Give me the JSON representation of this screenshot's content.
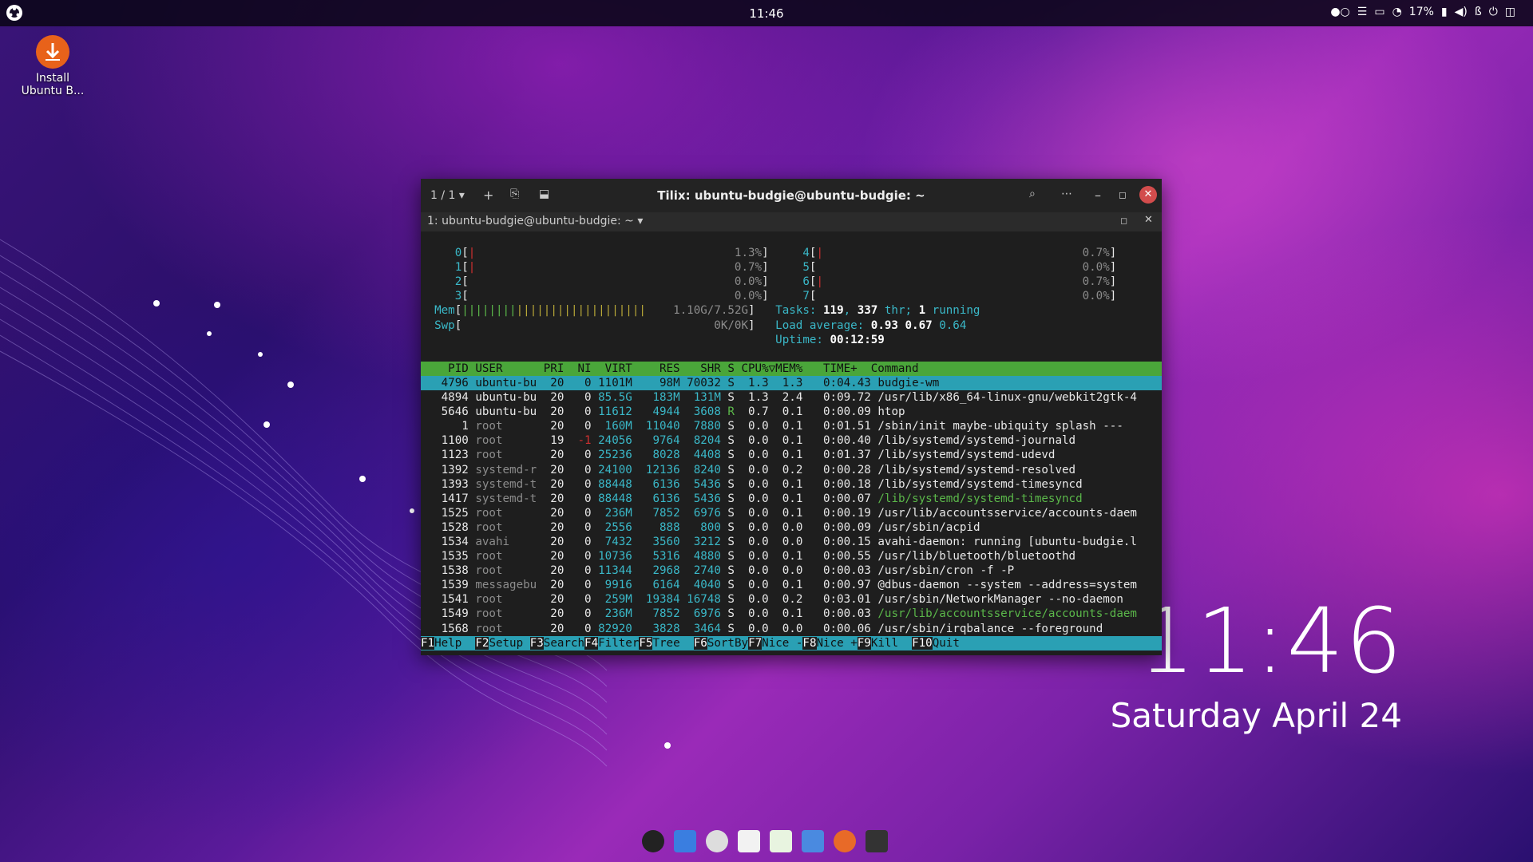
{
  "top_panel": {
    "clock": "11:46",
    "tray": {
      "battery": "17%"
    }
  },
  "desktop_icons": [
    {
      "label": "Install Ubuntu B..."
    }
  ],
  "desktop_clock": {
    "time": "11:46",
    "date": "Saturday April 24"
  },
  "terminal": {
    "session_indicator": "1 / 1",
    "title": "Tilix: ubuntu-budgie@ubuntu-budgie: ~",
    "tab_label": "1: ubuntu-budgie@ubuntu-budgie: ~",
    "cpus": [
      {
        "id": "0",
        "value": "1.3%"
      },
      {
        "id": "1",
        "value": "0.7%"
      },
      {
        "id": "2",
        "value": "0.0%"
      },
      {
        "id": "3",
        "value": "0.0%"
      },
      {
        "id": "4",
        "value": "0.7%"
      },
      {
        "id": "5",
        "value": "0.0%"
      },
      {
        "id": "6",
        "value": "0.7%"
      },
      {
        "id": "7",
        "value": "0.0%"
      }
    ],
    "mem": "1.10G/7.52G",
    "swp": "0K/0K",
    "tasks": {
      "label": "Tasks:",
      "count": "119",
      "thr": "337",
      "thr_label": "thr;",
      "running": "1",
      "running_label": "running"
    },
    "load": {
      "label": "Load average:",
      "a": "0.93",
      "b": "0.67",
      "c": "0.64"
    },
    "uptime": {
      "label": "Uptime:",
      "value": "00:12:59"
    },
    "columns": [
      "PID",
      "USER",
      "PRI",
      "NI",
      "VIRT",
      "RES",
      "SHR",
      "S",
      "CPU%",
      "MEM%",
      "TIME+",
      "Command"
    ],
    "processes": [
      {
        "pid": "4796",
        "user": "ubuntu-bu",
        "pri": "20",
        "ni": "0",
        "virt": "1101M",
        "res": "98M",
        "shr": "70032",
        "s": "S",
        "cpu": "1.3",
        "mem": "1.3",
        "time": "0:04.43",
        "cmd": "budgie-wm"
      },
      {
        "pid": "4894",
        "user": "ubuntu-bu",
        "pri": "20",
        "ni": "0",
        "virt": "85.5G",
        "res": "183M",
        "shr": "131M",
        "s": "S",
        "cpu": "1.3",
        "mem": "2.4",
        "time": "0:09.72",
        "cmd": "/usr/lib/x86_64-linux-gnu/webkit2gtk-4"
      },
      {
        "pid": "5646",
        "user": "ubuntu-bu",
        "pri": "20",
        "ni": "0",
        "virt": "11612",
        "res": "4944",
        "shr": "3608",
        "s": "R",
        "cpu": "0.7",
        "mem": "0.1",
        "time": "0:00.09",
        "cmd": "htop"
      },
      {
        "pid": "1",
        "user": "root",
        "pri": "20",
        "ni": "0",
        "virt": "160M",
        "res": "11040",
        "shr": "7880",
        "s": "S",
        "cpu": "0.0",
        "mem": "0.1",
        "time": "0:01.51",
        "cmd": "/sbin/init maybe-ubiquity splash ---"
      },
      {
        "pid": "1100",
        "user": "root",
        "pri": "19",
        "ni": "-1",
        "virt": "24056",
        "res": "9764",
        "shr": "8204",
        "s": "S",
        "cpu": "0.0",
        "mem": "0.1",
        "time": "0:00.40",
        "cmd": "/lib/systemd/systemd-journald"
      },
      {
        "pid": "1123",
        "user": "root",
        "pri": "20",
        "ni": "0",
        "virt": "25236",
        "res": "8028",
        "shr": "4408",
        "s": "S",
        "cpu": "0.0",
        "mem": "0.1",
        "time": "0:01.37",
        "cmd": "/lib/systemd/systemd-udevd"
      },
      {
        "pid": "1392",
        "user": "systemd-r",
        "pri": "20",
        "ni": "0",
        "virt": "24100",
        "res": "12136",
        "shr": "8240",
        "s": "S",
        "cpu": "0.0",
        "mem": "0.2",
        "time": "0:00.28",
        "cmd": "/lib/systemd/systemd-resolved"
      },
      {
        "pid": "1393",
        "user": "systemd-t",
        "pri": "20",
        "ni": "0",
        "virt": "88448",
        "res": "6136",
        "shr": "5436",
        "s": "S",
        "cpu": "0.0",
        "mem": "0.1",
        "time": "0:00.18",
        "cmd": "/lib/systemd/systemd-timesyncd"
      },
      {
        "pid": "1417",
        "user": "systemd-t",
        "pri": "20",
        "ni": "0",
        "virt": "88448",
        "res": "6136",
        "shr": "5436",
        "s": "S",
        "cpu": "0.0",
        "mem": "0.1",
        "time": "0:00.07",
        "cmd": "/lib/systemd/systemd-timesyncd"
      },
      {
        "pid": "1525",
        "user": "root",
        "pri": "20",
        "ni": "0",
        "virt": "236M",
        "res": "7852",
        "shr": "6976",
        "s": "S",
        "cpu": "0.0",
        "mem": "0.1",
        "time": "0:00.19",
        "cmd": "/usr/lib/accountsservice/accounts-daem"
      },
      {
        "pid": "1528",
        "user": "root",
        "pri": "20",
        "ni": "0",
        "virt": "2556",
        "res": "888",
        "shr": "800",
        "s": "S",
        "cpu": "0.0",
        "mem": "0.0",
        "time": "0:00.09",
        "cmd": "/usr/sbin/acpid"
      },
      {
        "pid": "1534",
        "user": "avahi",
        "pri": "20",
        "ni": "0",
        "virt": "7432",
        "res": "3560",
        "shr": "3212",
        "s": "S",
        "cpu": "0.0",
        "mem": "0.0",
        "time": "0:00.15",
        "cmd": "avahi-daemon: running [ubuntu-budgie.l"
      },
      {
        "pid": "1535",
        "user": "root",
        "pri": "20",
        "ni": "0",
        "virt": "10736",
        "res": "5316",
        "shr": "4880",
        "s": "S",
        "cpu": "0.0",
        "mem": "0.1",
        "time": "0:00.55",
        "cmd": "/usr/lib/bluetooth/bluetoothd"
      },
      {
        "pid": "1538",
        "user": "root",
        "pri": "20",
        "ni": "0",
        "virt": "11344",
        "res": "2968",
        "shr": "2740",
        "s": "S",
        "cpu": "0.0",
        "mem": "0.0",
        "time": "0:00.03",
        "cmd": "/usr/sbin/cron -f -P"
      },
      {
        "pid": "1539",
        "user": "messagebu",
        "pri": "20",
        "ni": "0",
        "virt": "9916",
        "res": "6164",
        "shr": "4040",
        "s": "S",
        "cpu": "0.0",
        "mem": "0.1",
        "time": "0:00.97",
        "cmd": "@dbus-daemon --system --address=system"
      },
      {
        "pid": "1541",
        "user": "root",
        "pri": "20",
        "ni": "0",
        "virt": "259M",
        "res": "19384",
        "shr": "16748",
        "s": "S",
        "cpu": "0.0",
        "mem": "0.2",
        "time": "0:03.01",
        "cmd": "/usr/sbin/NetworkManager --no-daemon"
      },
      {
        "pid": "1549",
        "user": "root",
        "pri": "20",
        "ni": "0",
        "virt": "236M",
        "res": "7852",
        "shr": "6976",
        "s": "S",
        "cpu": "0.0",
        "mem": "0.1",
        "time": "0:00.03",
        "cmd": "/usr/lib/accountsservice/accounts-daem"
      },
      {
        "pid": "1568",
        "user": "root",
        "pri": "20",
        "ni": "0",
        "virt": "82920",
        "res": "3828",
        "shr": "3464",
        "s": "S",
        "cpu": "0.0",
        "mem": "0.0",
        "time": "0:00.06",
        "cmd": "/usr/sbin/irqbalance --foreground"
      }
    ],
    "fkeys": [
      {
        "key": "F1",
        "label": "Help  "
      },
      {
        "key": "F2",
        "label": "Setup "
      },
      {
        "key": "F3",
        "label": "Search"
      },
      {
        "key": "F4",
        "label": "Filter"
      },
      {
        "key": "F5",
        "label": "Tree  "
      },
      {
        "key": "F6",
        "label": "SortBy"
      },
      {
        "key": "F7",
        "label": "Nice -"
      },
      {
        "key": "F8",
        "label": "Nice +"
      },
      {
        "key": "F9",
        "label": "Kill  "
      },
      {
        "key": "F10",
        "label": "Quit"
      }
    ]
  },
  "colors": {
    "htop_header": "#4aa63a",
    "htop_selected": "#2aa0b4",
    "close_button": "#d24c4c"
  },
  "dock_icons": [
    "budgie-menu-icon",
    "blue-app-icon",
    "sound-icon",
    "text-editor-icon",
    "spreadsheet-icon",
    "files-icon",
    "firefox-icon",
    "terminal-icon"
  ]
}
